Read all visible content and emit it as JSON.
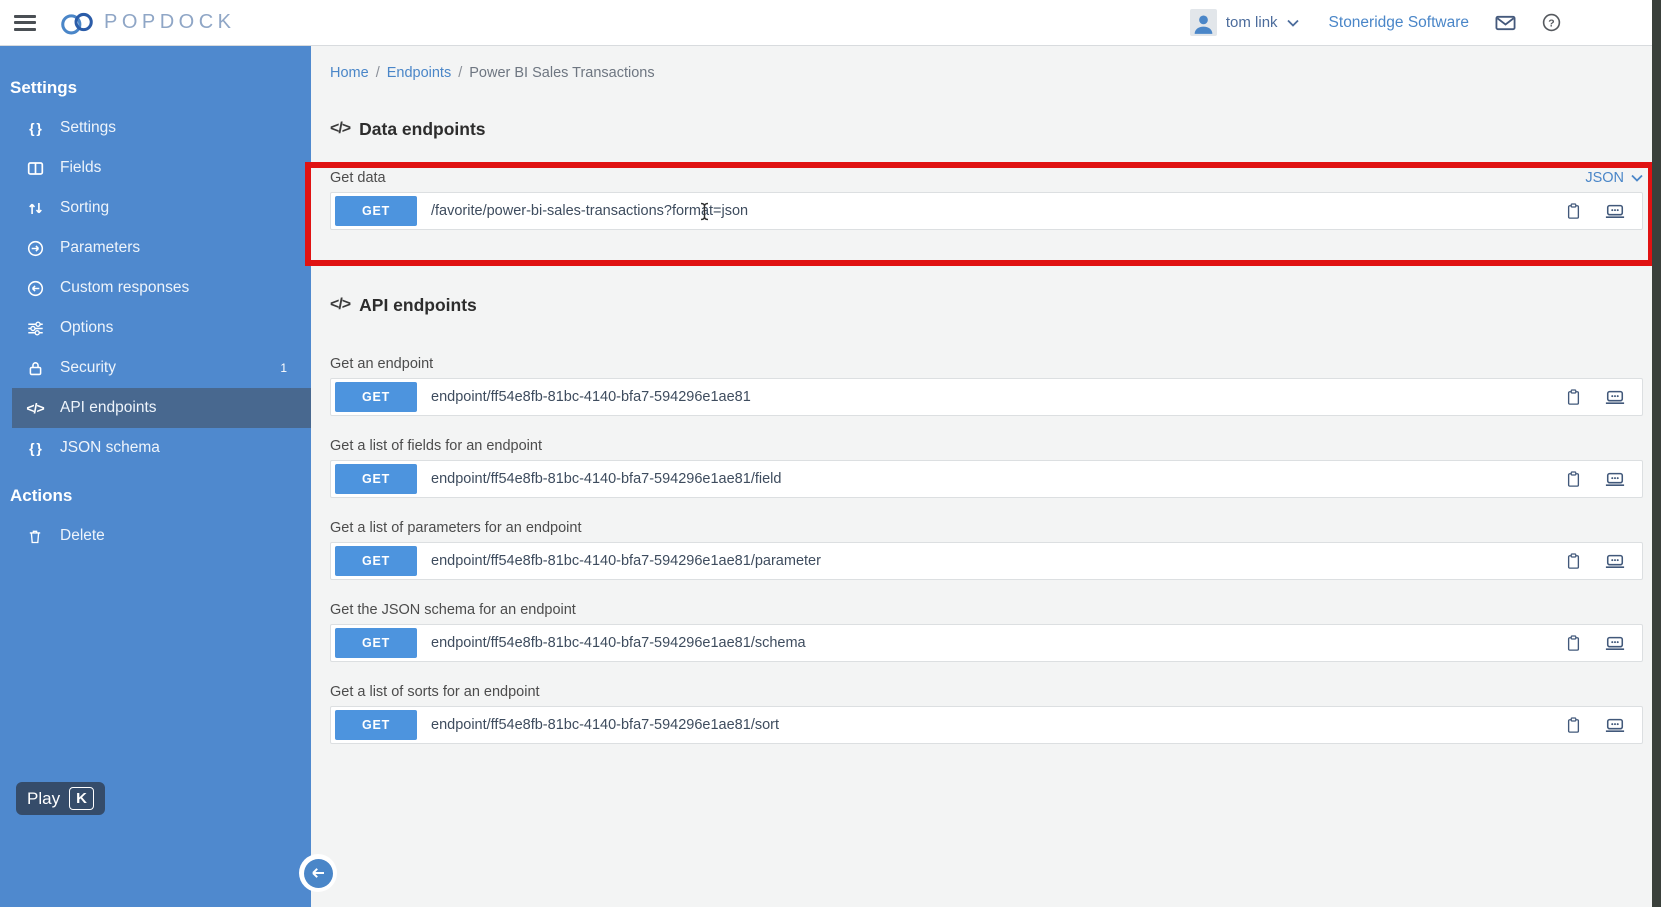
{
  "header": {
    "logo_text": "POPDOCK",
    "user_name": "tom link",
    "org_name": "Stoneridge Software"
  },
  "icons": {
    "code": "</>",
    "braces": "{ }"
  },
  "sidebar": {
    "sections": [
      {
        "title": "Settings",
        "items": [
          {
            "label": "Settings",
            "icon": "braces-icon"
          },
          {
            "label": "Fields",
            "icon": "columns-icon"
          },
          {
            "label": "Sorting",
            "icon": "sort-icon"
          },
          {
            "label": "Parameters",
            "icon": "arrow-circle-right-icon"
          },
          {
            "label": "Custom responses",
            "icon": "arrow-circle-left-icon"
          },
          {
            "label": "Options",
            "icon": "sliders-icon"
          },
          {
            "label": "Security",
            "icon": "lock-icon",
            "badge": "1"
          },
          {
            "label": "API endpoints",
            "icon": "code-icon",
            "selected": true
          },
          {
            "label": "JSON schema",
            "icon": "braces-icon"
          }
        ]
      },
      {
        "title": "Actions",
        "items": [
          {
            "label": "Delete",
            "icon": "trash-icon"
          }
        ]
      }
    ]
  },
  "breadcrumb": {
    "separator": "/",
    "items": [
      "Home",
      "Endpoints",
      "Power BI Sales Transactions"
    ]
  },
  "data_endpoints": {
    "heading": "Data endpoints",
    "format": "JSON",
    "row": {
      "label": "Get data",
      "method": "GET",
      "url": "/favorite/power-bi-sales-transactions?format=json"
    }
  },
  "api_endpoints": {
    "heading": "API endpoints",
    "rows": [
      {
        "label": "Get an endpoint",
        "method": "GET",
        "url": "endpoint/ff54e8fb-81bc-4140-bfa7-594296e1ae81"
      },
      {
        "label": "Get a list of fields for an endpoint",
        "method": "GET",
        "url": "endpoint/ff54e8fb-81bc-4140-bfa7-594296e1ae81/field"
      },
      {
        "label": "Get a list of parameters for an endpoint",
        "method": "GET",
        "url": "endpoint/ff54e8fb-81bc-4140-bfa7-594296e1ae81/parameter"
      },
      {
        "label": "Get the JSON schema for an endpoint",
        "method": "GET",
        "url": "endpoint/ff54e8fb-81bc-4140-bfa7-594296e1ae81/schema"
      },
      {
        "label": "Get a list of sorts for an endpoint",
        "method": "GET",
        "url": "endpoint/ff54e8fb-81bc-4140-bfa7-594296e1ae81/sort"
      }
    ]
  },
  "overlay": {
    "play_label": "Play",
    "play_key": "K"
  },
  "colors": {
    "sidebar_blue": "#4f89ce",
    "selected_item_blue": "#48688f",
    "link_blue": "#4a86c8",
    "get_button_blue": "#4d94de",
    "annotation_red": "#e01212"
  }
}
